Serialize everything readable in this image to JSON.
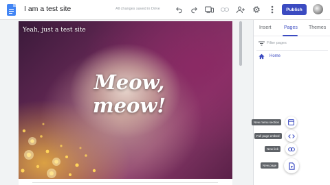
{
  "app": {
    "site_title": "I am a test site",
    "save_status": "All changes saved in Drive",
    "publish_label": "Publish"
  },
  "toolbar": {
    "icons": [
      "undo-icon",
      "redo-icon",
      "preview-icon",
      "link-icon",
      "share-icon",
      "settings-icon",
      "more-icon"
    ]
  },
  "hero": {
    "site_name": "Yeah, just a test site",
    "title_line1": "Meow,",
    "title_line2": "meow!"
  },
  "panel": {
    "tabs": [
      {
        "label": "Insert",
        "active": false
      },
      {
        "label": "Pages",
        "active": true
      },
      {
        "label": "Themes",
        "active": false
      }
    ],
    "filter_placeholder": "Filter pages",
    "pages": [
      {
        "label": "Home"
      }
    ]
  },
  "fab_menu": {
    "items": [
      {
        "tooltip": "New menu section",
        "icon": "menu-section-icon"
      },
      {
        "tooltip": "Full page embed",
        "icon": "code-icon"
      },
      {
        "tooltip": "New link",
        "icon": "link-icon"
      },
      {
        "tooltip": "New page",
        "icon": "new-page-icon"
      }
    ]
  },
  "colors": {
    "accent": "#3b4bc1",
    "docs_blue": "#4285f4",
    "tooltip_bg": "#5f6368"
  }
}
